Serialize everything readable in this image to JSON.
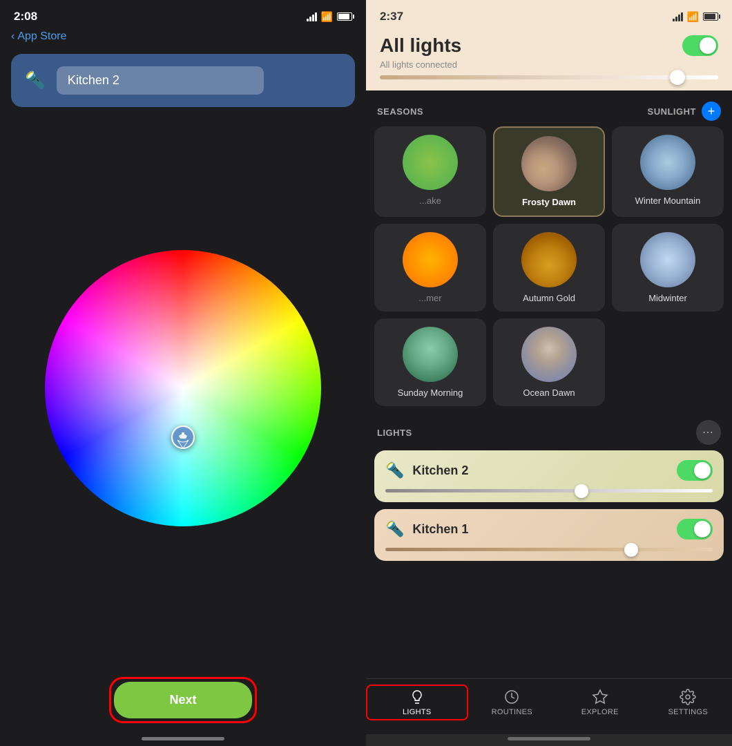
{
  "left": {
    "statusBar": {
      "time": "2:08",
      "backLabel": "App Store"
    },
    "lightCard": {
      "name": "Kitchen 2"
    },
    "nextButton": "Next"
  },
  "right": {
    "statusBar": {
      "time": "2:37"
    },
    "header": {
      "title": "All lights",
      "subtitle": "All lights connected"
    },
    "sections": {
      "seasons": "SEASONS",
      "sunlight": "SUNLIGHT"
    },
    "scenes": [
      {
        "name": "Frosty Dawn",
        "style": "frosty-dawn"
      },
      {
        "name": "Winter Mountain",
        "style": "winter-mountain"
      },
      {
        "name": "Sunday Morning",
        "style": "sunday-morning"
      },
      {
        "name": "Autumn Gold",
        "style": "autumn-gold"
      },
      {
        "name": "Midwinter",
        "style": "midwinter"
      },
      {
        "name": "Ocean Dawn",
        "style": "ocean-dawn"
      }
    ],
    "lightsSection": "LIGHTS",
    "lights": [
      {
        "name": "Kitchen 2",
        "cardClass": "kitchen2"
      },
      {
        "name": "Kitchen 1",
        "cardClass": "kitchen1"
      }
    ],
    "nav": {
      "items": [
        {
          "label": "LIGHTS",
          "active": true
        },
        {
          "label": "ROUTINES",
          "active": false
        },
        {
          "label": "EXPLORE",
          "active": false
        },
        {
          "label": "SETTINGS",
          "active": false
        }
      ]
    }
  }
}
